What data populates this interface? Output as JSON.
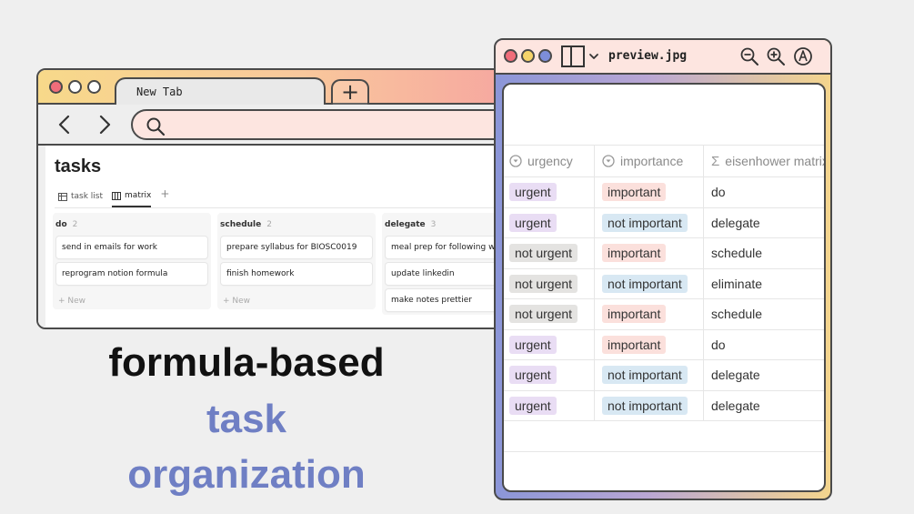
{
  "browser": {
    "tab_title": "New Tab",
    "new_tab_label": "+"
  },
  "notion": {
    "page_title": "tasks",
    "views": [
      {
        "label": "task list",
        "icon": "table-icon"
      },
      {
        "label": "matrix",
        "icon": "board-icon",
        "active": true
      }
    ],
    "add_view_label": "+",
    "columns": [
      {
        "name": "do",
        "count": "2",
        "cards": [
          "send in emails for work",
          "reprogram notion formula"
        ],
        "new_label": "+ New"
      },
      {
        "name": "schedule",
        "count": "2",
        "cards": [
          "prepare syllabus for BIOSC0019",
          "finish homework"
        ],
        "new_label": "+ New"
      },
      {
        "name": "delegate",
        "count": "3",
        "cards": [
          "meal prep for following week",
          "update linkedin",
          "make notes prettier"
        ]
      }
    ]
  },
  "preview": {
    "title": "preview.jpg",
    "table": {
      "headers": {
        "urgency": "urgency",
        "importance": "importance",
        "matrix": "eisenhower matrix"
      },
      "rows": [
        {
          "urgency": "urgent",
          "importance": "important",
          "matrix": "do"
        },
        {
          "urgency": "urgent",
          "importance": "not important",
          "matrix": "delegate"
        },
        {
          "urgency": "not urgent",
          "importance": "important",
          "matrix": "schedule"
        },
        {
          "urgency": "not urgent",
          "importance": "not important",
          "matrix": "eliminate"
        },
        {
          "urgency": "not urgent",
          "importance": "important",
          "matrix": "schedule"
        },
        {
          "urgency": "urgent",
          "importance": "important",
          "matrix": "do"
        },
        {
          "urgency": "urgent",
          "importance": "not important",
          "matrix": "delegate"
        },
        {
          "urgency": "urgent",
          "importance": "not important",
          "matrix": "delegate"
        }
      ]
    }
  },
  "caption": {
    "line1": "formula-based",
    "line2": "task",
    "line3": "organization"
  },
  "colors": {
    "urgent": "#e9ddf4",
    "not_urgent": "#e4e3e1",
    "important": "#fbe0dc",
    "not_important": "#d8e8f3",
    "caption_black": "#111111",
    "caption_blue": "#6f7fc4",
    "dot_red": "#f06d7a",
    "dot_yellow": "#f6d46a",
    "dot_blue": "#7d8ed9"
  }
}
